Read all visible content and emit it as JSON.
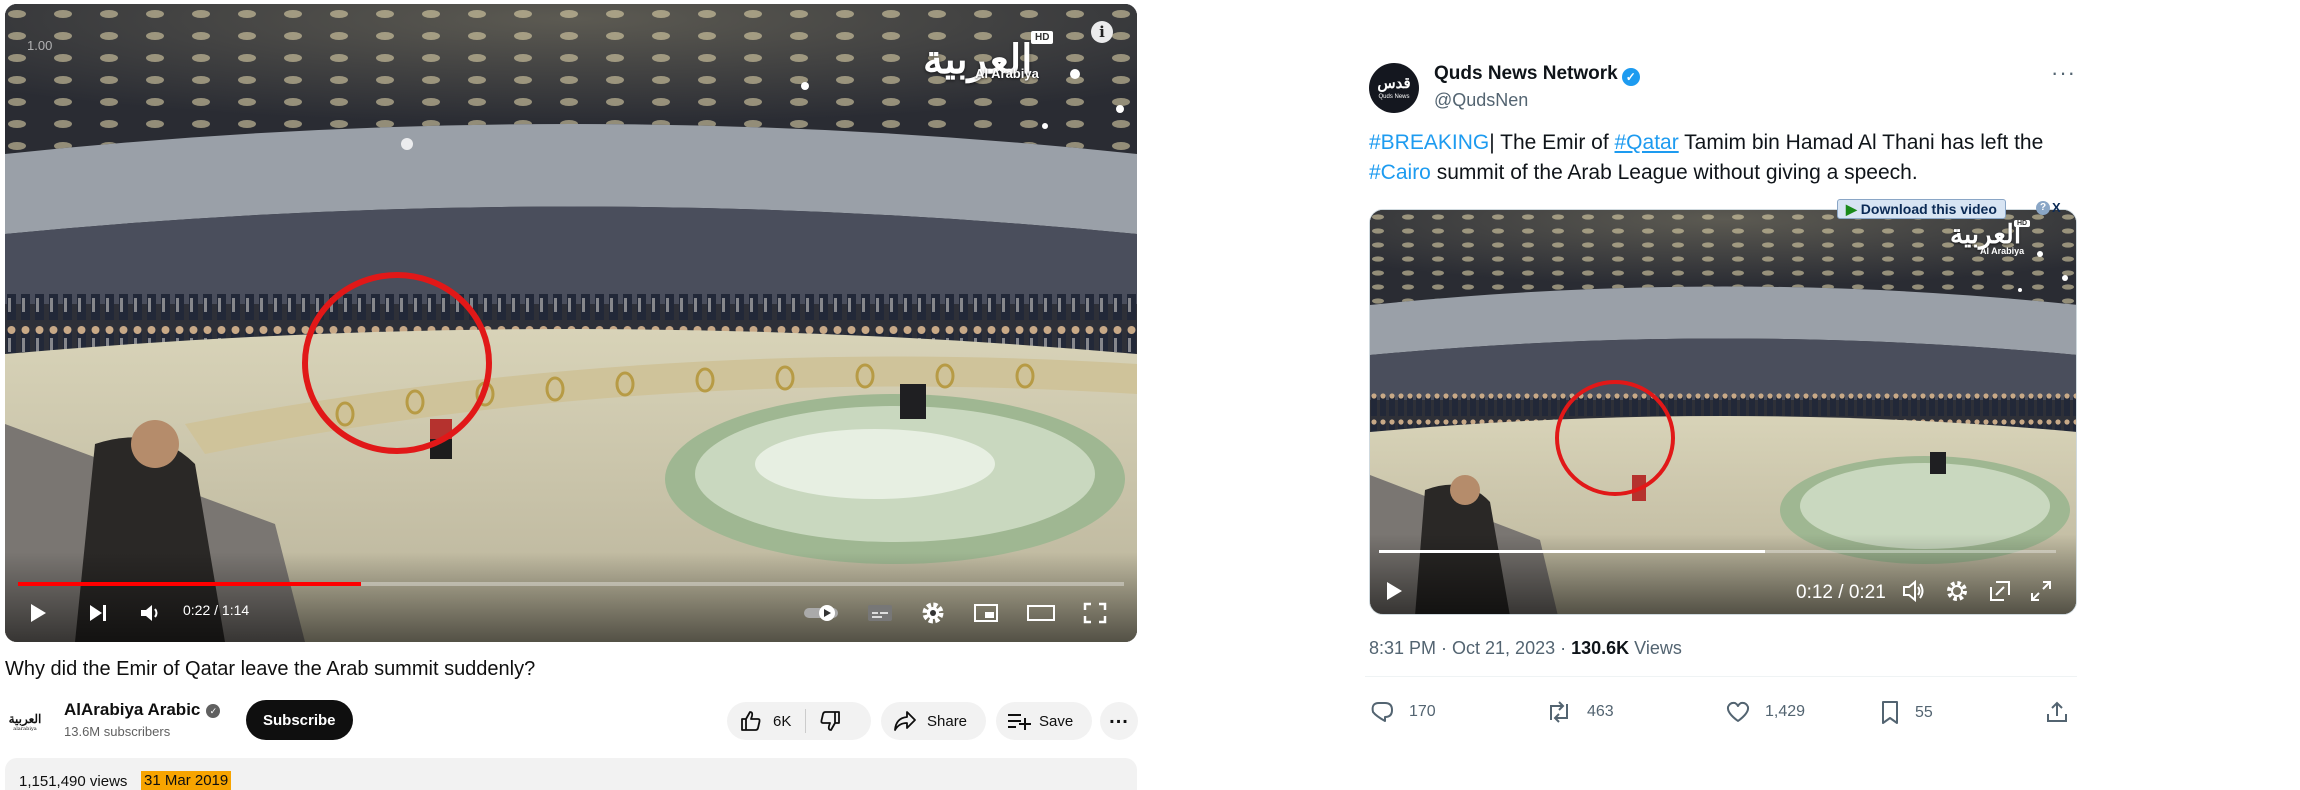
{
  "youtube": {
    "player": {
      "speed_overlay": "1.00",
      "channel_logo_text": "العربية",
      "channel_logo_sub": "Al Arabiya",
      "hd_badge": "HD",
      "info_icon": "info-icon",
      "progress": 0.31,
      "time": "0:22 / 1:14"
    },
    "title": "Why did the Emir of Qatar leave the Arab summit suddenly?",
    "channel": {
      "avatar_text": "العربية",
      "avatar_sub": "alarabiya",
      "name": "AlArabiya Arabic",
      "subscribers": "13.6M subscribers",
      "subscribe_label": "Subscribe"
    },
    "actions": {
      "likes": "6K",
      "share_label": "Share",
      "save_label": "Save"
    },
    "description": {
      "views": "1,151,490 views",
      "date": "31 Mar 2019"
    },
    "colors": {
      "progress": "#ff0000",
      "subscribe_bg": "#0f0f0f",
      "date_highlight": "#f7a400"
    }
  },
  "twitter": {
    "avatar_text": "قدس",
    "avatar_sub": "Quds News",
    "name": "Quds News Network",
    "handle": "@QudsNen",
    "text": {
      "tag1": "#BREAKING",
      "t1": "| The Emir of ",
      "tag2": "#Qatar",
      "t2": " Tamim bin Hamad Al Thani has left the ",
      "tag3": "#Cairo",
      "t3": " summit of the Arab League without giving a speech."
    },
    "media": {
      "download_label": "Download this video",
      "help": "?",
      "close": "X",
      "logo_text": "العربية",
      "logo_sub": "Al Arabiya",
      "hd_badge": "HD",
      "progress": 0.57,
      "time": "0:12 / 0:21"
    },
    "meta": {
      "time_date": "8:31 PM · Oct 21, 2023 · ",
      "views_count": "130.6K",
      "views_label": " Views"
    },
    "actions": {
      "replies": "170",
      "reposts": "463",
      "likes": "1,429",
      "bookmarks": "55"
    },
    "colors": {
      "link": "#1d9bf0",
      "text": "#0f1419",
      "muted": "#536471"
    }
  }
}
